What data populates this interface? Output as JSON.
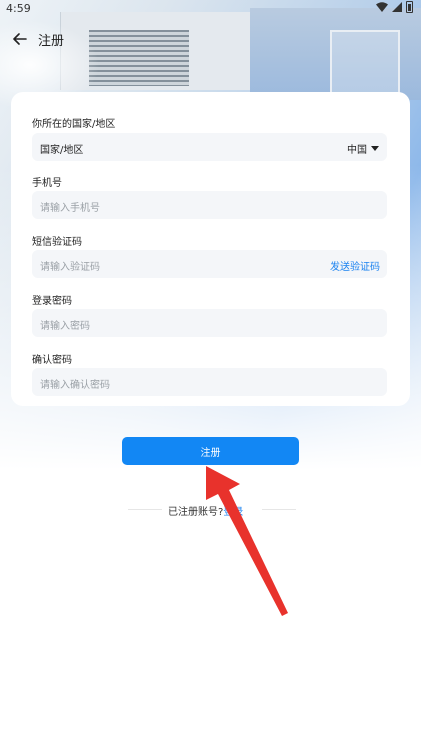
{
  "status_bar": {
    "time": "4:59"
  },
  "header": {
    "title": "注册"
  },
  "form": {
    "region": {
      "label": "你所在的国家/地区",
      "field_text": "国家/地区",
      "selected": "中国"
    },
    "phone": {
      "label": "手机号",
      "placeholder": "请输入手机号"
    },
    "sms": {
      "label": "短信验证码",
      "placeholder": "请输入验证码",
      "send_link": "发送验证码"
    },
    "password": {
      "label": "登录密码",
      "placeholder": "请输入密码"
    },
    "confirm": {
      "label": "确认密码",
      "placeholder": "请输入确认密码"
    }
  },
  "register_button": "注册",
  "login_prompt": {
    "text": "已注册账号?",
    "link": "登录"
  },
  "colors": {
    "accent": "#1287f4",
    "link": "#1a82f0",
    "annotation": "#e8322c"
  },
  "icons": {
    "back": "back-arrow-icon",
    "dropdown": "caret-down-icon"
  }
}
